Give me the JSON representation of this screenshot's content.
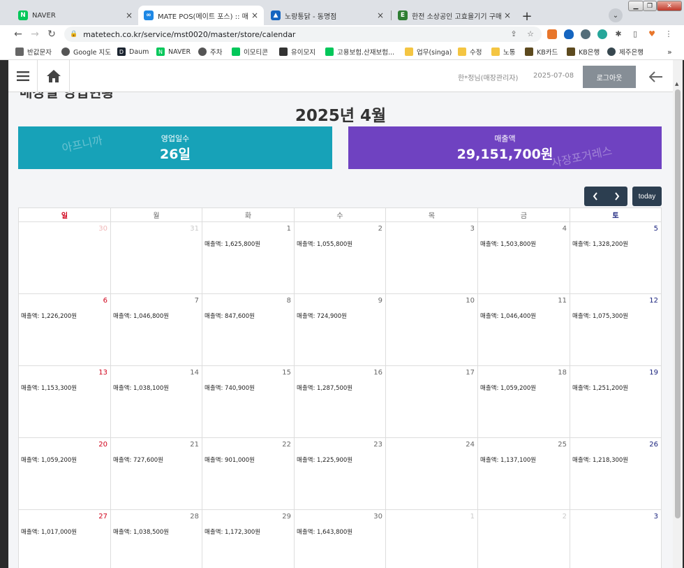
{
  "browser": {
    "tabs": [
      {
        "title": "NAVER",
        "favicon_color": "#03c75a",
        "favicon_text": "N"
      },
      {
        "title": "MATE POS(메이트 포스) :: 매장관리",
        "favicon_color": "#1e88e5",
        "favicon_text": "∞",
        "active": true
      },
      {
        "title": "노랑통닭 - 동명점",
        "favicon_color": "#1565c0",
        "favicon_text": "▲"
      },
      {
        "title": "한전 소상공인 고효율기기 구매지원",
        "favicon_color": "#2e7d32",
        "favicon_text": "E"
      }
    ],
    "new_tab": "+",
    "tab_close": "×",
    "url": "matetech.co.kr/service/mst0020/master/store/calendar",
    "bookmarks": [
      {
        "label": "반값문자",
        "color": "#555"
      },
      {
        "label": "Google 지도",
        "color": "#555"
      },
      {
        "label": "Daum",
        "color": "#1b2430"
      },
      {
        "label": "NAVER",
        "color": "#03c75a"
      },
      {
        "label": "주차",
        "color": "#555"
      },
      {
        "label": "이모티콘",
        "color": "#03c75a"
      },
      {
        "label": "유이모지",
        "color": "#333"
      },
      {
        "label": "고용보험.산재보험...",
        "color": "#03c75a"
      },
      {
        "label": "업무(singa)",
        "color": "#f4c542"
      },
      {
        "label": "수정",
        "color": "#f4c542"
      },
      {
        "label": "노통",
        "color": "#f4c542"
      },
      {
        "label": "KB카드",
        "color": "#5d4a1f"
      },
      {
        "label": "KB은행",
        "color": "#5d4a1f"
      },
      {
        "label": "제주은행",
        "color": "#37474f"
      }
    ]
  },
  "header": {
    "user": "한*정님(매장관리자)",
    "date": "2025-07-08",
    "logout_label": "로그아웃"
  },
  "page": {
    "title": "매장별 영업현황",
    "month_title": "2025년 4월",
    "watermark_left": "아프니까",
    "watermark_right": "사장포거레스",
    "today_label": "today"
  },
  "stats": {
    "business_days_label": "영업일수",
    "business_days_value": "26일",
    "sales_label": "매출액",
    "sales_value": "29,151,700원"
  },
  "calendar": {
    "weekdays": [
      "일",
      "월",
      "화",
      "수",
      "목",
      "금",
      "토"
    ],
    "sales_prefix": "매출액: ",
    "weeks": [
      [
        {
          "day": "30",
          "other": true,
          "sales": ""
        },
        {
          "day": "31",
          "other": true,
          "sales": ""
        },
        {
          "day": "1",
          "sales": "1,625,800원"
        },
        {
          "day": "2",
          "sales": "1,055,800원"
        },
        {
          "day": "3",
          "sales": ""
        },
        {
          "day": "4",
          "sales": "1,503,800원"
        },
        {
          "day": "5",
          "sales": "1,328,200원"
        }
      ],
      [
        {
          "day": "6",
          "sales": "1,226,200원"
        },
        {
          "day": "7",
          "sales": "1,046,800원"
        },
        {
          "day": "8",
          "sales": "847,600원"
        },
        {
          "day": "9",
          "sales": "724,900원"
        },
        {
          "day": "10",
          "sales": ""
        },
        {
          "day": "11",
          "sales": "1,046,400원"
        },
        {
          "day": "12",
          "sales": "1,075,300원"
        }
      ],
      [
        {
          "day": "13",
          "sales": "1,153,300원"
        },
        {
          "day": "14",
          "sales": "1,038,100원"
        },
        {
          "day": "15",
          "sales": "740,900원"
        },
        {
          "day": "16",
          "sales": "1,287,500원"
        },
        {
          "day": "17",
          "sales": ""
        },
        {
          "day": "18",
          "sales": "1,059,200원"
        },
        {
          "day": "19",
          "sales": "1,251,200원"
        }
      ],
      [
        {
          "day": "20",
          "sales": "1,059,200원"
        },
        {
          "day": "21",
          "sales": "727,600원"
        },
        {
          "day": "22",
          "sales": "901,000원"
        },
        {
          "day": "23",
          "sales": "1,225,900원"
        },
        {
          "day": "24",
          "sales": ""
        },
        {
          "day": "25",
          "sales": "1,137,100원"
        },
        {
          "day": "26",
          "sales": "1,218,300원"
        }
      ],
      [
        {
          "day": "27",
          "sales": "1,017,000원"
        },
        {
          "day": "28",
          "sales": "1,038,500원"
        },
        {
          "day": "29",
          "sales": "1,172,300원"
        },
        {
          "day": "30",
          "sales": "1,643,800원"
        },
        {
          "day": "1",
          "other": true,
          "sales": ""
        },
        {
          "day": "2",
          "other": true,
          "sales": ""
        },
        {
          "day": "3",
          "other": true,
          "sales": ""
        }
      ]
    ]
  },
  "colors": {
    "days_card": "#17a2b8",
    "sales_card": "#6f42c1",
    "nav_button": "#2c3e50",
    "logout_button": "#868e96"
  }
}
